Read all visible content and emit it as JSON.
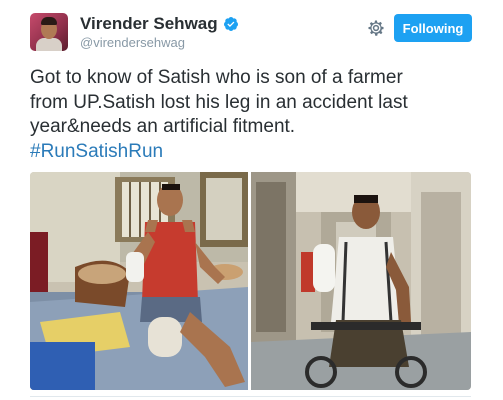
{
  "user": {
    "display_name": "Virender Sehwag",
    "handle": "@virendersehwag",
    "verified": true,
    "avatar_icon": "profile-photo"
  },
  "actions": {
    "settings_icon": "gear-icon",
    "follow_label": "Following",
    "follow_color": "#1da1f2"
  },
  "tweet": {
    "line_1": "Got to know of Satish who is son of a farmer",
    "line_2": "from UP.Satish lost his leg in an accident last",
    "line_3": "year&needs an artificial fitment.",
    "hashtag": "#RunSatishRun"
  },
  "media": {
    "photo_count": 2
  },
  "colors": {
    "link": "#2b7bb9",
    "text": "#292f33",
    "secondary": "#8899a6"
  }
}
